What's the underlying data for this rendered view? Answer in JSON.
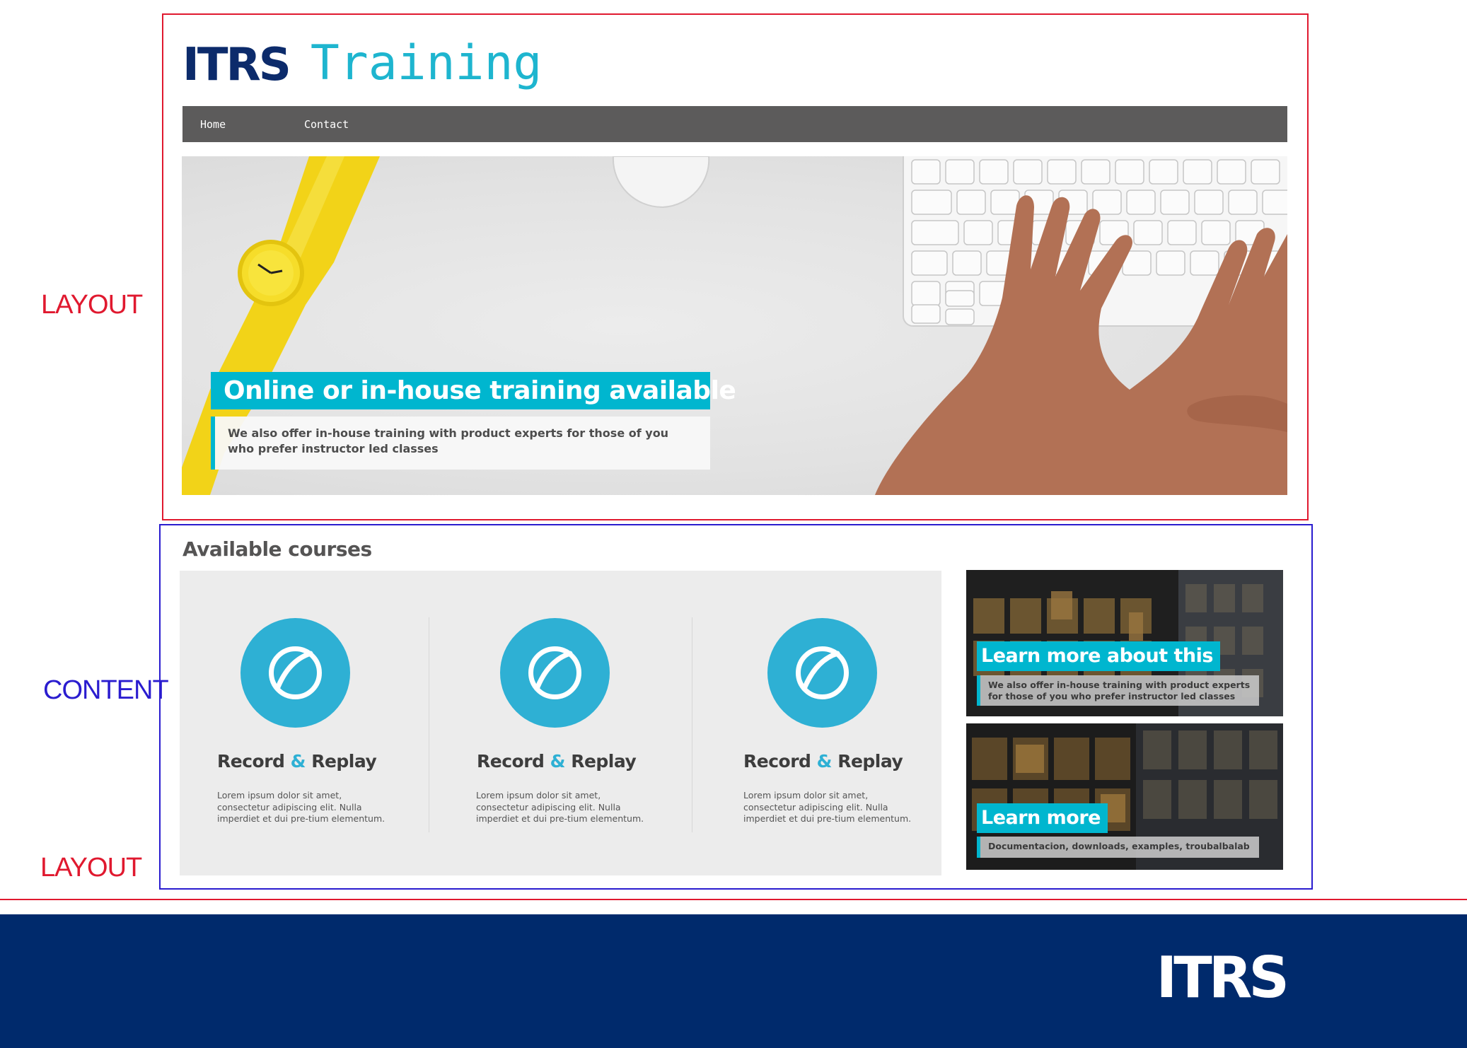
{
  "annotations": {
    "layout_top": "LAYOUT",
    "content": "CONTENT",
    "layout_bottom": "LAYOUT"
  },
  "header": {
    "logo_brand": "ITRS",
    "logo_product": "Training"
  },
  "nav": {
    "items": [
      {
        "label": "Home"
      },
      {
        "label": "Contact"
      }
    ]
  },
  "hero": {
    "title": "Online or in-house training available",
    "description": "We also offer in-house training with product experts for those of you who prefer instructor led classes"
  },
  "courses": {
    "heading": "Available courses",
    "items": [
      {
        "title_part1": "Record",
        "title_amp": "&",
        "title_part2": "Replay",
        "description": "Lorem ipsum dolor sit amet, consectetur adipiscing elit. Nulla imperdiet et dui pre-tium elementum."
      },
      {
        "title_part1": "Record",
        "title_amp": "&",
        "title_part2": "Replay",
        "description": "Lorem ipsum dolor sit amet, consectetur adipiscing elit. Nulla imperdiet et dui pre-tium elementum."
      },
      {
        "title_part1": "Record",
        "title_amp": "&",
        "title_part2": "Replay",
        "description": "Lorem ipsum dolor sit amet, consectetur adipiscing elit. Nulla imperdiet et dui pre-tium elementum."
      }
    ]
  },
  "promos": [
    {
      "title": "Learn more about this",
      "description": "We also offer in-house training with product experts for those of you who prefer instructor led classes"
    },
    {
      "title": "Learn more",
      "description": "Documentacion, downloads, examples, troubalbalab"
    }
  ],
  "footer": {
    "logo": "ITRS"
  },
  "colors": {
    "brand_navy": "#002a6c",
    "accent_cyan": "#00b6cf",
    "icon_blue": "#2eb0d4",
    "nav_gray": "#5c5b5b",
    "annotation_red": "#e0192f",
    "annotation_blue": "#2a1ccf"
  }
}
